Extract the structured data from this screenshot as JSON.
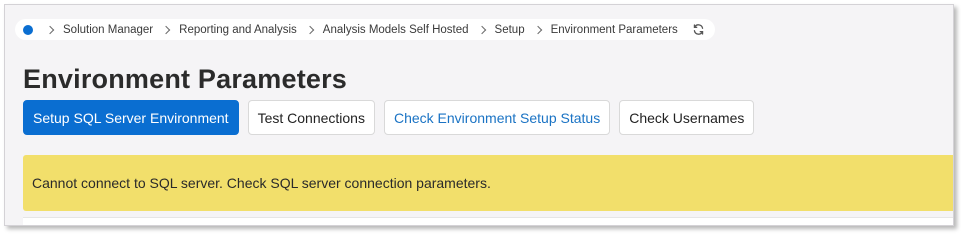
{
  "breadcrumb": {
    "items": [
      {
        "label": "Solution Manager"
      },
      {
        "label": "Reporting and Analysis"
      },
      {
        "label": "Analysis Models Self Hosted"
      },
      {
        "label": "Setup"
      },
      {
        "label": "Environment Parameters"
      }
    ],
    "home_icon": "home-dot-icon",
    "refresh_icon": "refresh-icon"
  },
  "page": {
    "title": "Environment Parameters"
  },
  "toolbar": {
    "setup_sql_label": "Setup SQL Server Environment",
    "test_connections_label": "Test Connections",
    "check_status_label": "Check Environment Setup Status",
    "check_usernames_label": "Check Usernames"
  },
  "message": {
    "text": "Cannot connect to SQL server. Check SQL server connection parameters.",
    "type": "warning",
    "color": "#f2df6b"
  },
  "colors": {
    "accent": "#0a6ed1",
    "link": "#1a73c4"
  }
}
